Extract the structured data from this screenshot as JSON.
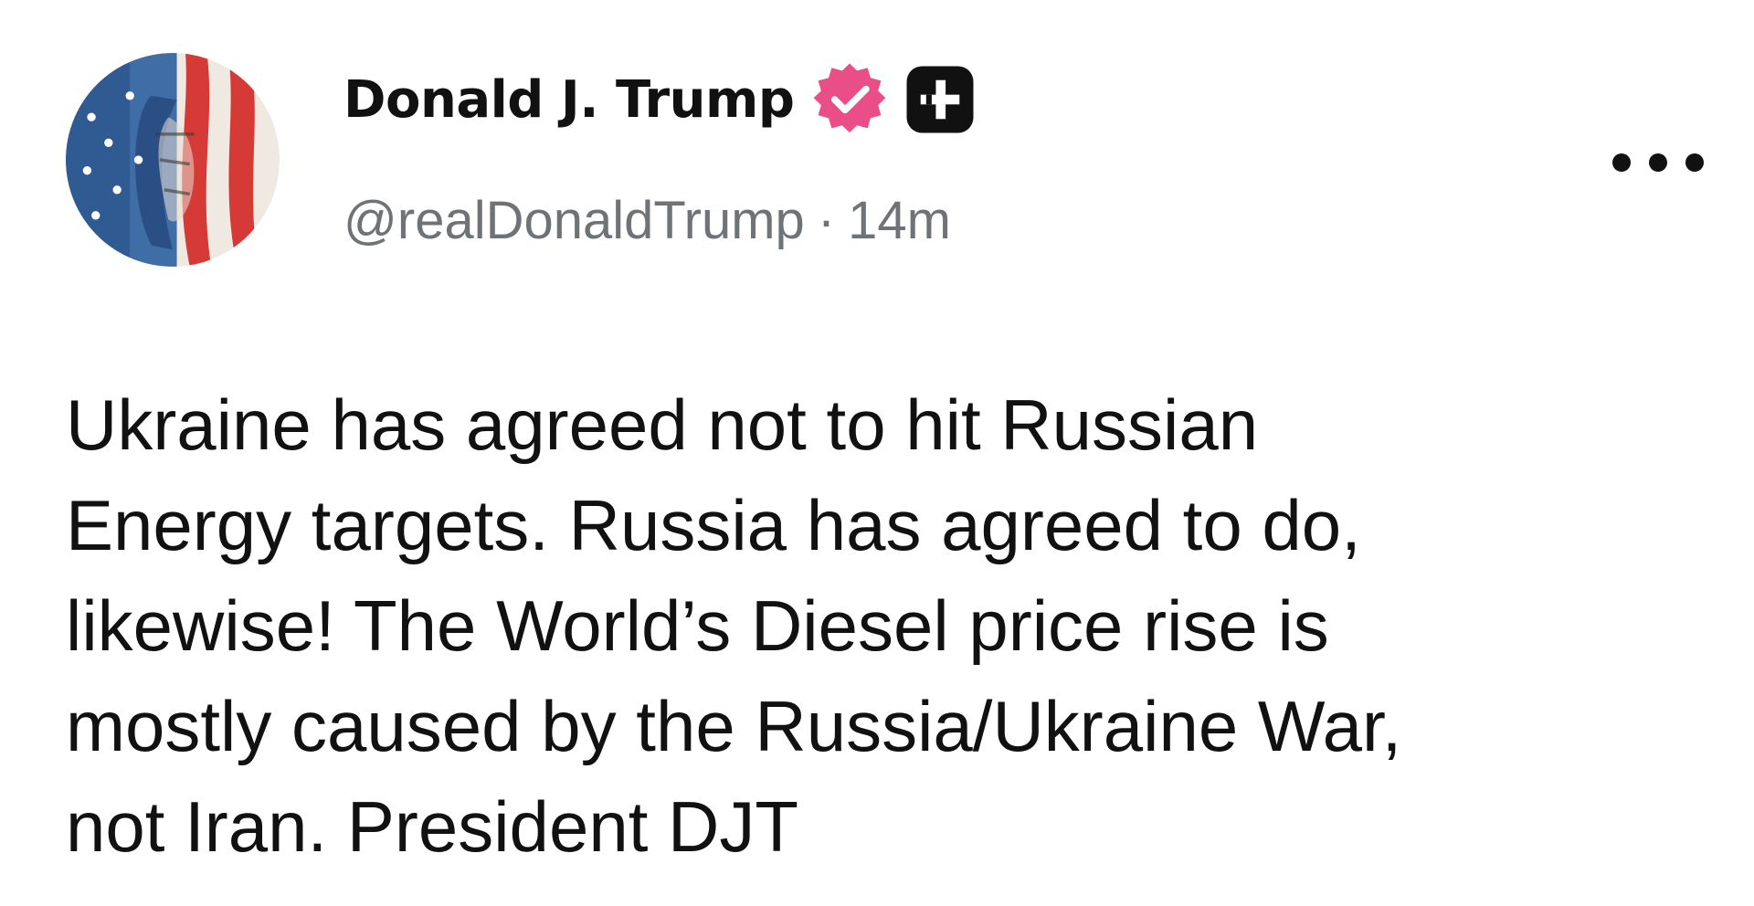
{
  "author": {
    "display_name": "Donald J. Trump",
    "handle": "@realDonaldTrump",
    "separator": "·",
    "time_ago": "14m",
    "verified_icon": "verified-badge-icon",
    "subscriber_icon": "plus-badge-icon",
    "avatar_icon": "flag-portrait-avatar"
  },
  "menu": {
    "more_icon": "more-horizontal-icon"
  },
  "post": {
    "lines": [
      "Ukraine has agreed not to hit Russian",
      "Energy targets. Russia has agreed to do,",
      "likewise! The World’s Diesel price rise is",
      "mostly caused by the Russia/Ukraine War,",
      "not Iran. President DJT"
    ]
  },
  "colors": {
    "text": "#111111",
    "secondary_text": "#6f7377",
    "verified_badge": "#e94f86",
    "background": "#ffffff"
  }
}
